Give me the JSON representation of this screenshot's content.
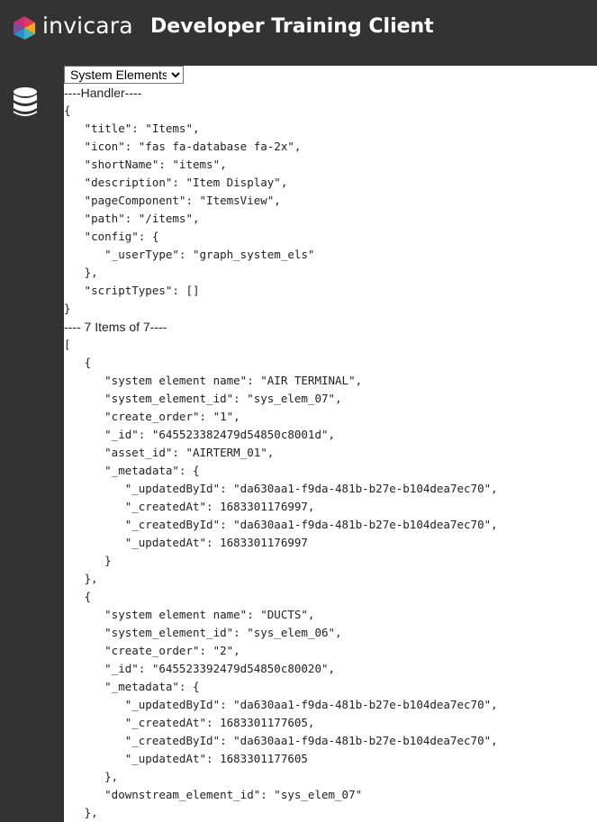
{
  "header": {
    "brand": "invicara",
    "title": "Developer Training Client"
  },
  "sidebar": {
    "items": [
      {
        "icon": "database-icon"
      }
    ]
  },
  "main": {
    "selector": {
      "selected": "System Elements",
      "options": [
        "System Elements"
      ]
    },
    "handler_label": "----Handler----",
    "handler_json": "{\n   \"title\": \"Items\",\n   \"icon\": \"fas fa-database fa-2x\",\n   \"shortName\": \"items\",\n   \"description\": \"Item Display\",\n   \"pageComponent\": \"ItemsView\",\n   \"path\": \"/items\",\n   \"config\": {\n      \"_userType\": \"graph_system_els\"\n   },\n   \"scriptTypes\": []\n}",
    "items_label": "---- 7 Items of 7----",
    "items_json": "[\n   {\n      \"system element name\": \"AIR TERMINAL\",\n      \"system_element_id\": \"sys_elem_07\",\n      \"create_order\": \"1\",\n      \"_id\": \"645523382479d54850c8001d\",\n      \"asset_id\": \"AIRTERM_01\",\n      \"_metadata\": {\n         \"_updatedById\": \"da630aa1-f9da-481b-b27e-b104dea7ec70\",\n         \"_createdAt\": 1683301176997,\n         \"_createdById\": \"da630aa1-f9da-481b-b27e-b104dea7ec70\",\n         \"_updatedAt\": 1683301176997\n      }\n   },\n   {\n      \"system element name\": \"DUCTS\",\n      \"system_element_id\": \"sys_elem_06\",\n      \"create_order\": \"2\",\n      \"_id\": \"645523392479d54850c80020\",\n      \"_metadata\": {\n         \"_updatedById\": \"da630aa1-f9da-481b-b27e-b104dea7ec70\",\n         \"_createdAt\": 1683301177605,\n         \"_createdById\": \"da630aa1-f9da-481b-b27e-b104dea7ec70\",\n         \"_updatedAt\": 1683301177605\n      },\n      \"downstream_element_id\": \"sys_elem_07\"\n   },"
  },
  "colors": {
    "chrome": "#333333",
    "logo": [
      "#e5375a",
      "#f7a823",
      "#3bb7c4",
      "#7b4fa0"
    ]
  }
}
